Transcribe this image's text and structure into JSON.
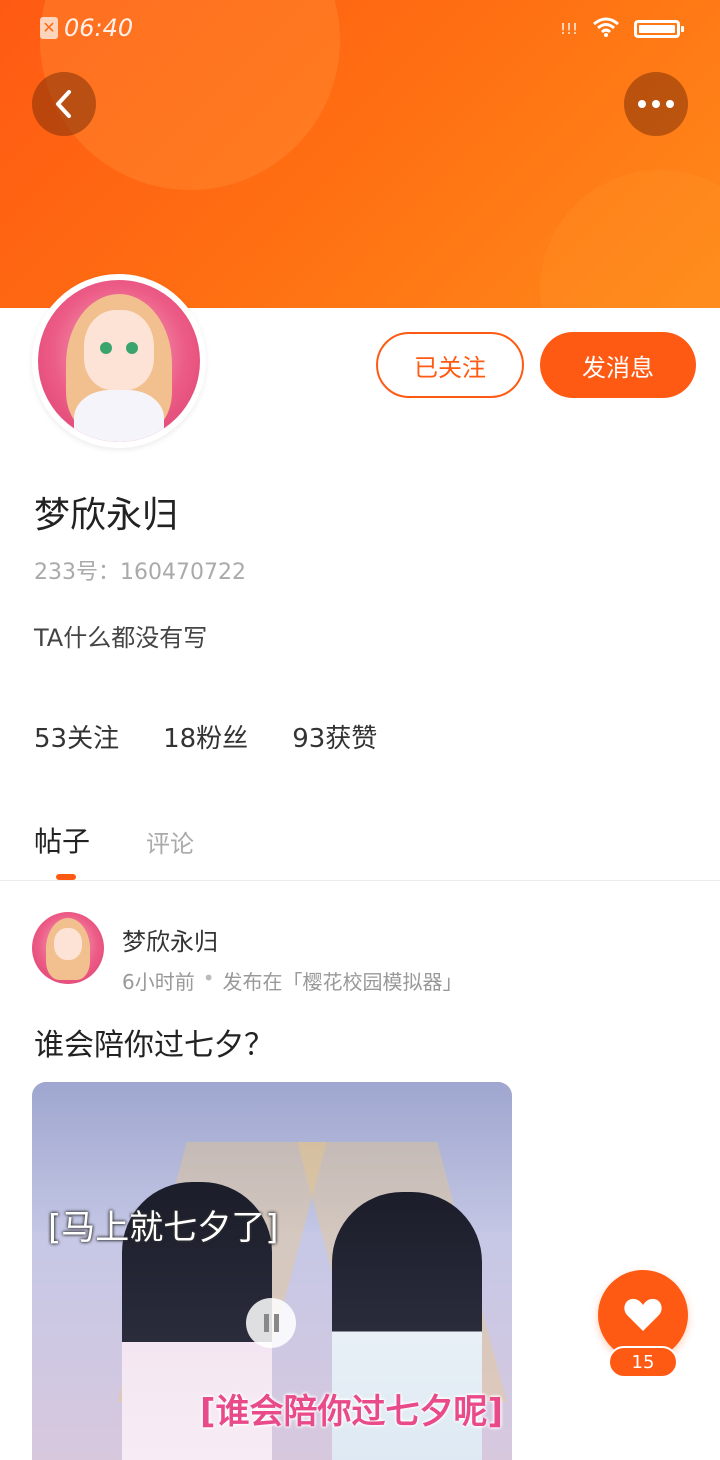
{
  "status_bar": {
    "time": "06:40",
    "signal": "!!!"
  },
  "header": {
    "back_icon": "chevron-left-icon",
    "more_icon": "more-dots-icon"
  },
  "profile": {
    "follow_label": "已关注",
    "message_label": "发消息",
    "username": "梦欣永归",
    "user_id": "233号：160470722",
    "bio": "TA什么都没有写",
    "stats": {
      "following": "53关注",
      "followers": "18粉丝",
      "likes": "93获赞"
    }
  },
  "tabs": {
    "posts": "帖子",
    "comments": "评论"
  },
  "post": {
    "author": "梦欣永归",
    "time": "6小时前",
    "published_in": "发布在「樱花校园模拟器」",
    "title": "谁会陪你过七夕？",
    "media_caption_top": "[马上就七夕了]",
    "media_caption_bottom": "[谁会陪你过七夕呢]"
  },
  "like": {
    "count": "15"
  },
  "colors": {
    "accent": "#ff5a13",
    "banner_end": "#ff8a1a"
  }
}
